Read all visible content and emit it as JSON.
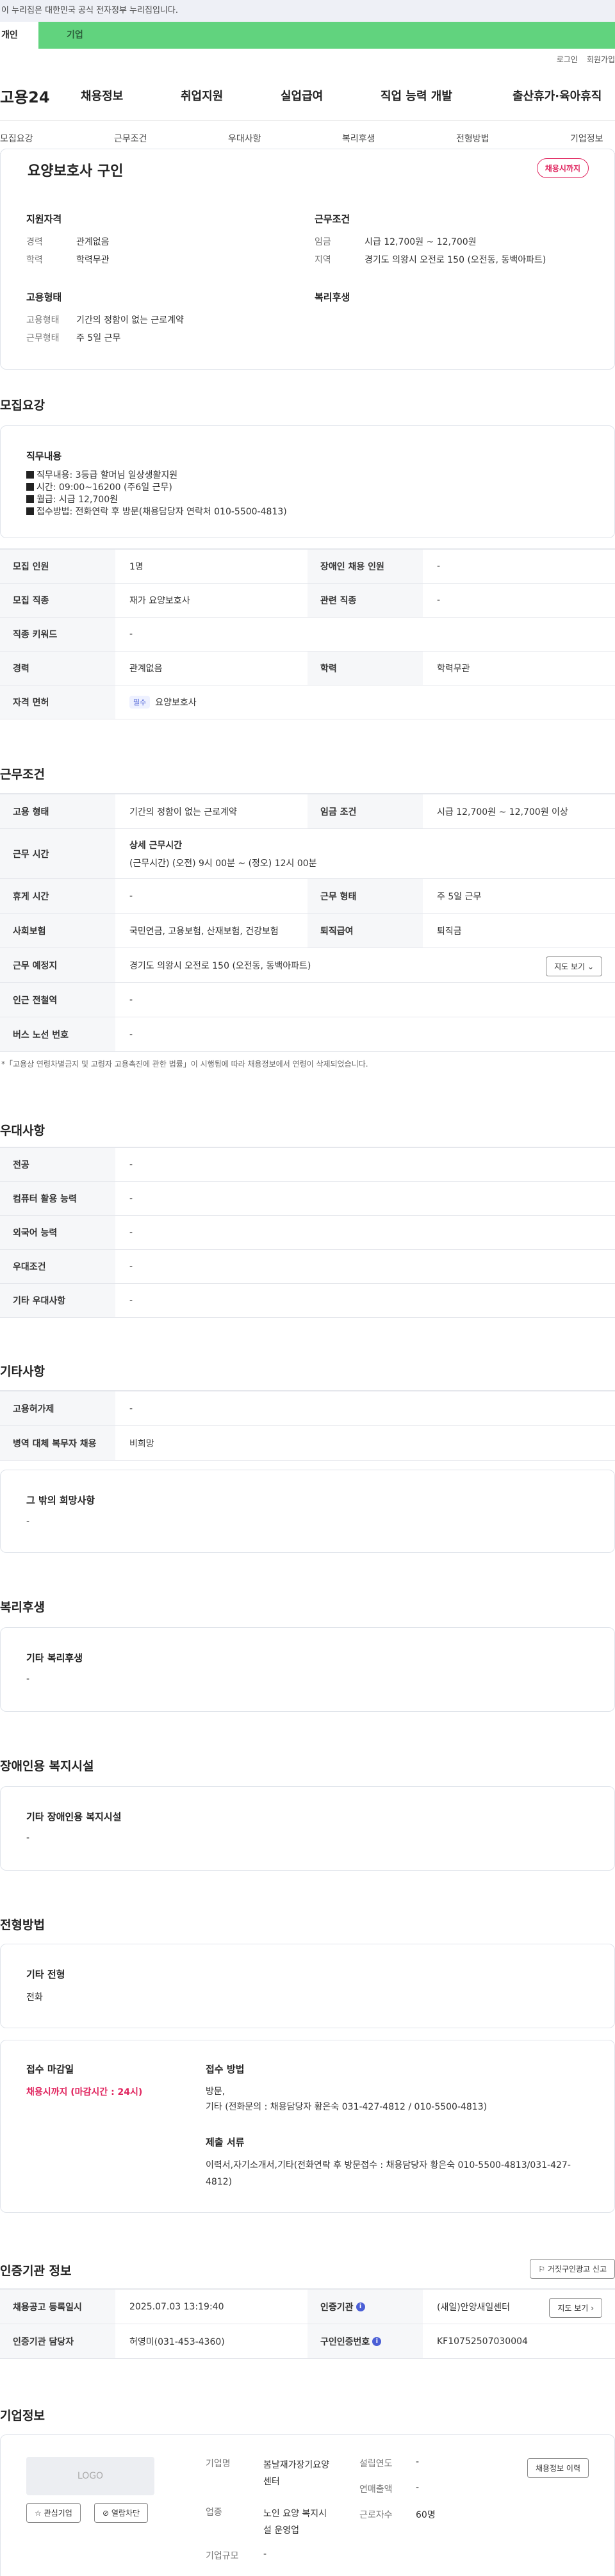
{
  "gov_banner": "이 누리집은 대한민국 공식 전자정부 누리집입니다.",
  "service_tabs": [
    "개인",
    "기업"
  ],
  "util": [
    "로그인",
    "회원가입"
  ],
  "logo": "고용24",
  "gnb": [
    "채용정보",
    "취업지원",
    "실업급여",
    "직업 능력 개발",
    "출산휴가·육아휴직"
  ],
  "tabs": [
    "모집요강",
    "근무조건",
    "우대사항",
    "복리후생",
    "전형방법",
    "기업정보"
  ],
  "summary": {
    "title": "요양보호사 구인",
    "badge": "채용시까지",
    "qual_title": "지원자격",
    "qual": [
      {
        "k": "경력",
        "v": "관계없음"
      },
      {
        "k": "학력",
        "v": "학력무관"
      }
    ],
    "cond_title": "근무조건",
    "cond": [
      {
        "k": "임금",
        "v": "시급 12,700원 ~ 12,700원"
      },
      {
        "k": "지역",
        "v": "경기도 의왕시 오전로 150 (오전동, 동백아파트)"
      }
    ],
    "emp_title": "고용형태",
    "emp": [
      {
        "k": "고용형태",
        "v": "기간의 정함이 없는 근로계약"
      },
      {
        "k": "근무형태",
        "v": "주 5일 근무"
      }
    ],
    "welfare_title": "복리후생"
  },
  "recruit": {
    "section": "모집요강",
    "duty_title": "직무내용",
    "duty_lines": [
      "직무내용: 3등급 할머님 일상생활지원",
      "시간: 09:00~16200 (주6일 근무)",
      "월급: 시급 12,700원",
      "접수방법: 전화연락 후 방문(채용담당자 연락처 010-5500-4813)"
    ],
    "rows": [
      {
        "th1": "모집 인원",
        "td1": "1명",
        "th2": "장애인 채용 인원",
        "td2": "-"
      },
      {
        "th1": "모집 직종",
        "td1": "재가 요양보호사",
        "th2": "관련 직종",
        "td2": "-"
      }
    ],
    "keyword_th": "직종 키워드",
    "keyword_td": "-",
    "edu_row": {
      "th1": "경력",
      "td1": "관계없음",
      "th2": "학력",
      "td2": "학력무관"
    },
    "license_th": "자격 면허",
    "license_chip": "필수",
    "license_td": "요양보호사"
  },
  "work": {
    "section": "근무조건",
    "r1": {
      "th1": "고용 형태",
      "td1": "기간의 정함이 없는 근로계약",
      "th2": "임금 조건",
      "td2": "시급 12,700원 ~ 12,700원 이상"
    },
    "hours_th": "근무 시간",
    "hours_title": "상세 근무시간",
    "hours_detail": "(근무시간) (오전) 9시 00분 ~ (정오) 12시 00분",
    "r3": {
      "th1": "휴게 시간",
      "td1": "-",
      "th2": "근무 형태",
      "td2": "주 5일 근무"
    },
    "r4": {
      "th1": "사회보험",
      "td1": "국민연금, 고용보험, 산재보험, 건강보험",
      "th2": "퇴직급여",
      "td2": "퇴직금"
    },
    "place_th": "근무 예정지",
    "place_td": "경기도 의왕시 오전로 150 (오전동, 동백아파트)",
    "map_btn": "지도 보기",
    "subway_th": "인근 전철역",
    "subway_td": "-",
    "bus_th": "버스 노선 번호",
    "bus_td": "-",
    "note": "*「고용상 연령차별금지 및 고령자 고용촉진에 관한 법률」이 시행됨에 따라 채용정보에서 연령이 삭제되었습니다."
  },
  "pref": {
    "section": "우대사항",
    "rows": [
      {
        "th": "전공",
        "td": "-"
      },
      {
        "th": "컴퓨터 활용 능력",
        "td": "-"
      },
      {
        "th": "외국어 능력",
        "td": "-"
      },
      {
        "th": "우대조건",
        "td": "-"
      },
      {
        "th": "기타 우대사항",
        "td": "-"
      }
    ]
  },
  "etc": {
    "section": "기타사항",
    "rows": [
      {
        "th": "고용허가제",
        "td": "-"
      },
      {
        "th": "병역 대체 복무자 채용",
        "td": "비희망"
      }
    ],
    "hope_title": "그 밖의 희망사항",
    "hope_value": "-"
  },
  "welfare": {
    "section": "복리후생",
    "title": "기타 복리후생",
    "value": "-"
  },
  "disabled": {
    "section": "장애인용 복지시설",
    "title": "기타 장애인용 복지시설",
    "value": "-"
  },
  "screening": {
    "section": "전형방법",
    "etc_title": "기타 전형",
    "etc_value": "전화",
    "deadline_title": "접수 마감일",
    "deadline_value": "채용시까지 (마감시간 : 24시)",
    "method_title": "접수 방법",
    "method_l1": "방문,",
    "method_l2": "기타 (전화문의 : 채용담당자 황은숙 031-427-4812 / 010-5500-4813)",
    "docs_title": "제출 서류",
    "docs_value": "이력서,자기소개서,기타(전화연락 후 방문접수 : 채용담당자 황은숙 010-5500-4813/031-427-4812)"
  },
  "agency": {
    "section": "인증기관 정보",
    "report_btn": "거짓구인광고 신고",
    "r1": {
      "th1": "채용공고 등록일시",
      "td1": "2025.07.03 13:19:40",
      "th2": "인증기관",
      "td2": "(새일)안양새일센터",
      "btn": "지도 보기"
    },
    "r2": {
      "th1": "인증기관 담당자",
      "td1": "허영미(031-453-4360)",
      "th2": "구인인증번호",
      "td2": "KF10752507030004"
    }
  },
  "company": {
    "section": "기업정보",
    "logo_text": "LOGO",
    "fav_btn": "관심기업",
    "block_btn": "열람차단",
    "name_k": "기업명",
    "name_v1": "봄날재가장기요양",
    "name_v2": "센터",
    "founded_k": "설립연도",
    "founded_v": "-",
    "revenue_k": "연매출액",
    "revenue_v": "-",
    "industry_k": "업종",
    "industry_v1": "노인 요양 복지시",
    "industry_v2": "설 운영업",
    "workers_k": "근로자수",
    "workers_v": "60명",
    "size_k": "기업규모",
    "size_v": "-",
    "history_btn": "채용정보 이력"
  }
}
